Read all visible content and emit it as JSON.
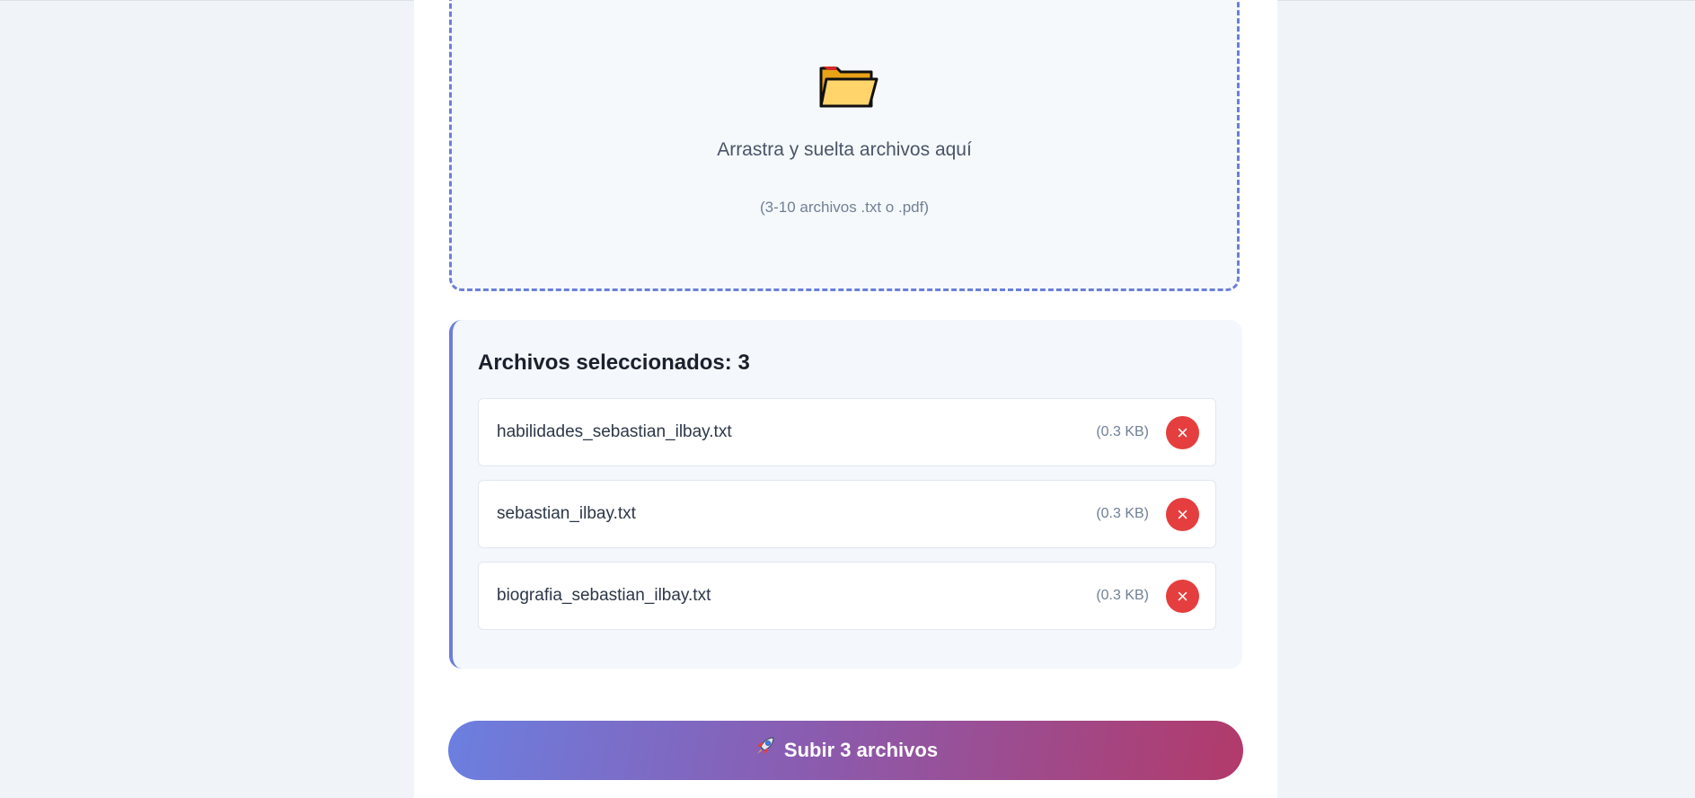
{
  "dropzone": {
    "icon": "folder-icon",
    "text": "Arrastra y suelta archivos aquí",
    "hint": "(3-10 archivos .txt o .pdf)"
  },
  "files": {
    "title": "Archivos seleccionados: 3",
    "items": [
      {
        "name": "habilidades_sebastian_ilbay.txt",
        "size": "(0.3 KB)",
        "remove_label": "×"
      },
      {
        "name": "sebastian_ilbay.txt",
        "size": "(0.3 KB)",
        "remove_label": "×"
      },
      {
        "name": "biografia_sebastian_ilbay.txt",
        "size": "(0.3 KB)",
        "remove_label": "×"
      }
    ]
  },
  "upload": {
    "icon": "rocket-icon",
    "label": "Subir 3 archivos"
  },
  "colors": {
    "accent": "#6b7fd8",
    "danger": "#e53e3e",
    "gradient_start": "#6b7fe0",
    "gradient_end": "#b23a6a"
  }
}
